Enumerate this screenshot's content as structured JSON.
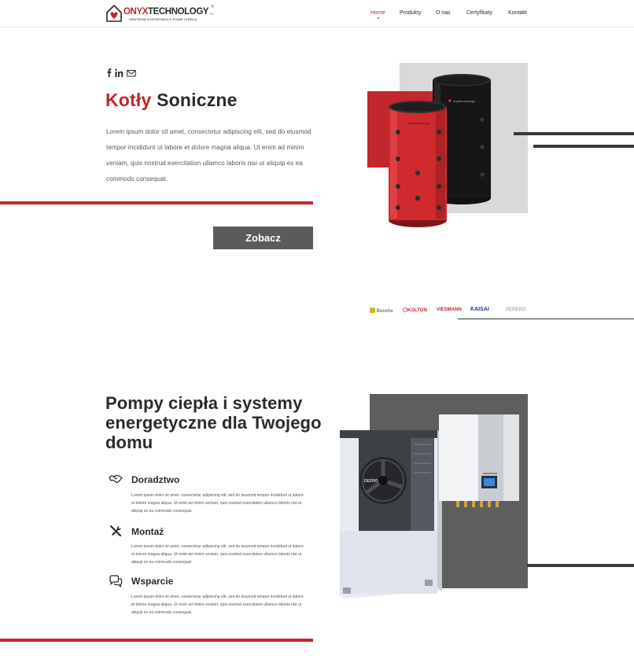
{
  "header": {
    "logo": {
      "brand_red": "ONYX",
      "brand_dark": "TECHNOLOGY",
      "tld": ".PL",
      "reg": "®",
      "tagline": "CENTRUM DYSTRYBUCJI POMP CIEPŁA"
    },
    "nav": {
      "home": "Home",
      "produkty": "Produkty",
      "o_nas": "O nas",
      "certyfikaty": "Certyfikaty",
      "kontakt": "Kontakt"
    }
  },
  "hero": {
    "social_icons": [
      "facebook-icon",
      "linkedin-icon",
      "mail-icon"
    ],
    "title_red": "Kotły",
    "title_dark": "Soniczne",
    "text": "Lorem ipsum dolor sit amet, consectetur adipiscing elit, sed do eiusmod tempor incididunt ut labore et dolore magna aliqua. Ut enim ad minim veniam, quis nostrud exercitation ullamco laboris nisi ut aliquip ex ea commodo consequat.",
    "button": "Zobacz"
  },
  "brands": [
    "Beretta",
    "KOLTON",
    "VIESMANN",
    "KAISAI",
    "PEREKO"
  ],
  "section2": {
    "title": "Pompy ciepła i systemy energetyczne dla Twojego domu",
    "features": [
      {
        "icon": "handshake-icon",
        "title": "Doradztwo",
        "text": "Lorem ipsum dolor sit amet, consectetur adipiscing elit, sed do eiusmod tempor incididunt ut labore et dolore magna aliqua. Ut enim ad minim veniam, quis nostrud exercitation ullamco laboris nisi ut aliquip ex ea commodo consequat."
      },
      {
        "icon": "tools-icon",
        "title": "Montaż",
        "text": "Lorem ipsum dolor sit amet, consectetur adipiscing elit, sed do eiusmod tempor incididunt ut labore et dolore magna aliqua. Ut enim ad minim veniam, quis nostrud exercitation ullamco laboris nisi ut aliquip ex ea commodo consequat."
      },
      {
        "icon": "chat-icon",
        "title": "Wsparcie",
        "text": "Lorem ipsum dolor sit amet, consectetur adipiscing elit, sed do eiusmod tempor incididunt ut labore et dolore magna aliqua. Ut enim ad minim veniam, quis nostrud exercitation ullamco laboris nisi ut aliquip ex ea commodo consequat."
      }
    ]
  },
  "colors": {
    "accent": "#c1272d",
    "dark": "#2b2b2b",
    "button": "#5b5b5b",
    "panel_light": "#d9d9d9",
    "panel_dark": "#5e5e5e"
  }
}
